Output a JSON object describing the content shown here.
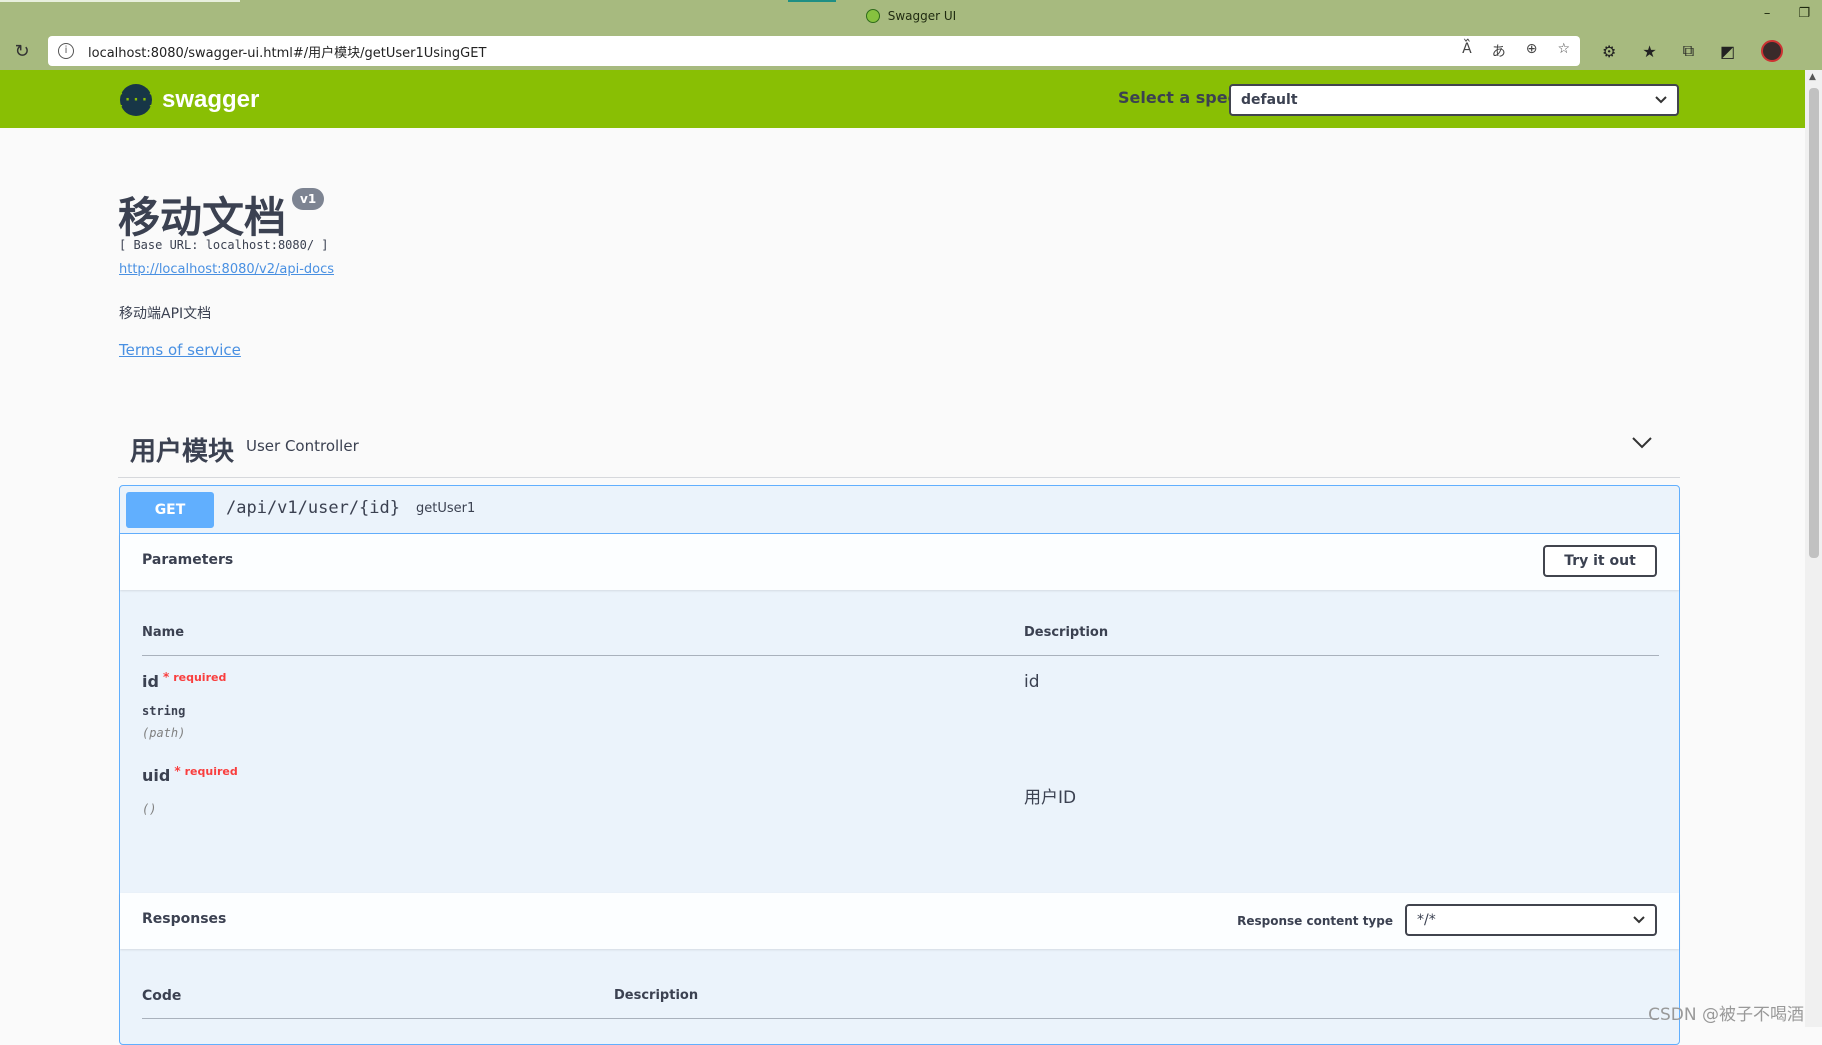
{
  "browser": {
    "window_title": "Swagger UI",
    "url": "localhost:8080/swagger-ui.html#/用户模块/getUser1UsingGET",
    "win_min": "–",
    "win_restore": "❐"
  },
  "topbar": {
    "logo_text": "swagger",
    "logo_mark": "{···}",
    "spec_label": "Select a spec",
    "spec_value": "default"
  },
  "info": {
    "title": "移动文档",
    "version": "v1",
    "base_url": "[ Base URL: localhost:8080/ ]",
    "api_docs_link": "http://localhost:8080/v2/api-docs",
    "description": "移动端API文档",
    "terms": "Terms of service"
  },
  "tag": {
    "name": "用户模块",
    "description": "User Controller"
  },
  "operation": {
    "method": "GET",
    "path": "/api/v1/user/{id}",
    "summary": "getUser1",
    "parameters_title": "Parameters",
    "try_it_out": "Try it out",
    "col_name": "Name",
    "col_description": "Description",
    "params": [
      {
        "name": "id",
        "star": "*",
        "required": "required",
        "type": "string",
        "in": "(path)",
        "description": "id"
      },
      {
        "name": "uid",
        "star": "*",
        "required": "required",
        "type": "",
        "in": "()",
        "description": "用户ID"
      }
    ],
    "responses_title": "Responses",
    "response_content_type_label": "Response content type",
    "response_content_type": "*/*",
    "col_code": "Code",
    "col_resp_description": "Description"
  },
  "watermark": "CSDN @被子不喝酒",
  "colors": {
    "topbar": "#89bf04",
    "get": "#61affe",
    "required": "#f93e3e",
    "link": "#4990e2"
  }
}
